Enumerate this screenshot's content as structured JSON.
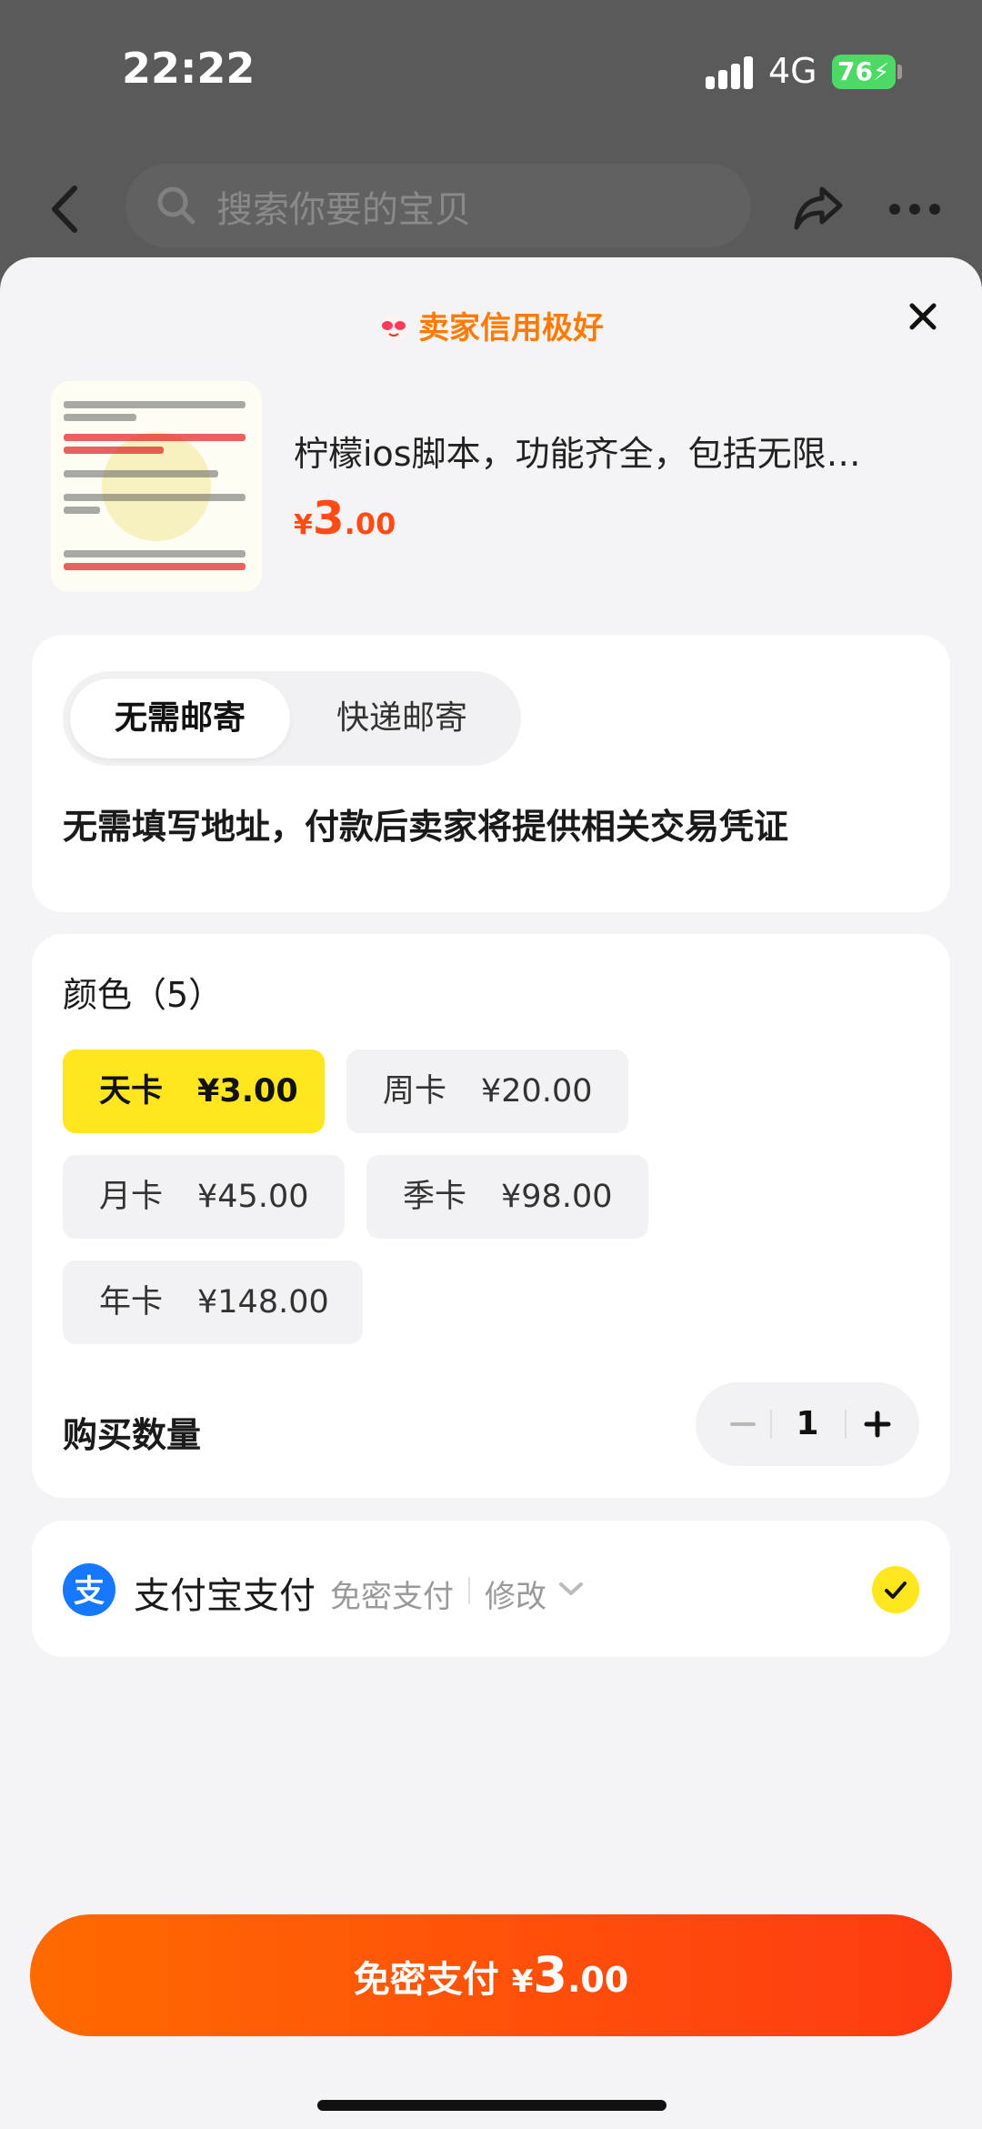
{
  "status_bar": {
    "time": "22:22",
    "network": "4G",
    "battery": "76"
  },
  "nav": {
    "search_placeholder": "搜索你要的宝贝"
  },
  "sheet": {
    "seller_badge": "卖家信用极好",
    "product": {
      "title": "柠檬ios脚本，功能齐全，包括无限…",
      "price_symbol": "¥",
      "price_int": "3",
      "price_dec": ".00",
      "thumb_lines": [
        "2.领日常任务→打开辅助→点日常任务（不要领辅助）",
        "3.切图跑图（白嫖一周以后再领，不急用不要领！）",
        "4.领取任务辅助，没事就下线吧！",
        "想玩娱乐功能的建议用小号玩，安全第一",
        "染料想跑就不要领，不影响使用，有封号的机率，自行考虑！染料都上百的宝子"
      ]
    },
    "shipping": {
      "options": [
        "无需邮寄",
        "快递邮寄"
      ],
      "selected": "无需邮寄",
      "description": "无需填写地址，付款后卖家将提供相关交易凭证"
    },
    "spec": {
      "title": "颜色（5）",
      "options": [
        {
          "name": "天卡",
          "price": "¥3.00",
          "selected": true
        },
        {
          "name": "周卡",
          "price": "¥20.00",
          "selected": false
        },
        {
          "name": "月卡",
          "price": "¥45.00",
          "selected": false
        },
        {
          "name": "季卡",
          "price": "¥98.00",
          "selected": false
        },
        {
          "name": "年卡",
          "price": "¥148.00",
          "selected": false
        }
      ]
    },
    "quantity": {
      "label": "购买数量",
      "value": "1",
      "minus": "−",
      "plus": "+"
    },
    "payment": {
      "method": "支付宝支付",
      "mode": "免密支付",
      "change": "修改",
      "selected": true
    },
    "pay_button": {
      "label": "免密支付",
      "price_symbol": "¥",
      "price_int": "3",
      "price_dec": ".00"
    }
  },
  "colors": {
    "accent_yellow": "#ffe61e",
    "price_orange": "#ff4b16",
    "badge_orange": "#ff7a00",
    "alipay_blue": "#1677ff"
  },
  "icons": [
    "back-icon",
    "search-icon",
    "share-icon",
    "more-icon",
    "close-icon",
    "alipay-icon",
    "checkmark-icon",
    "chevron-down-icon"
  ]
}
